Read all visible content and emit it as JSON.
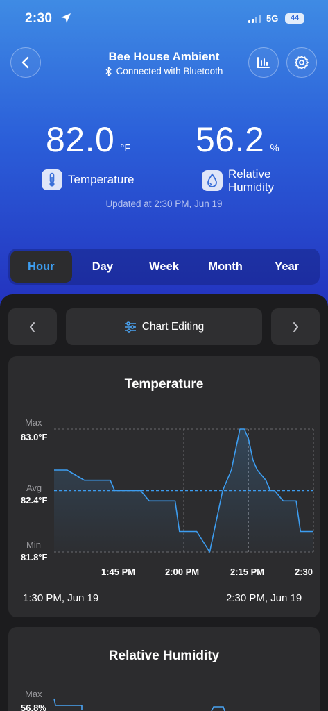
{
  "status": {
    "time": "2:30",
    "network": "5G",
    "battery": "44"
  },
  "header": {
    "title": "Bee House Ambient",
    "subtitle": "Connected with Bluetooth"
  },
  "icons": {
    "back": "chevron-left-icon",
    "bluetooth": "bluetooth-icon",
    "stats": "bar-chart-icon",
    "settings": "gear-icon",
    "thermometer": "thermometer-icon",
    "humidity": "humidity-drop-icon",
    "sliders": "sliders-icon"
  },
  "readings": {
    "temperature": {
      "value": "82.0",
      "unit": "°F",
      "label": "Temperature"
    },
    "humidity": {
      "value": "56.2",
      "unit": "%",
      "label_line1": "Relative",
      "label_line2": "Humidity"
    }
  },
  "updated": "Updated at 2:30 PM,  Jun 19",
  "tabs": [
    "Hour",
    "Day",
    "Week",
    "Month",
    "Year"
  ],
  "active_tab": "Hour",
  "toolbar": {
    "chart_editing": "Chart Editing"
  },
  "accent_color": "#3d9df0",
  "chart_data": [
    {
      "type": "line",
      "title": "Temperature",
      "y_labels": {
        "max_label": "Max",
        "max": "83.0°F",
        "avg_label": "Avg",
        "avg": "82.4°F",
        "min_label": "Min",
        "min": "81.8°F"
      },
      "ylim": [
        81.8,
        83.0
      ],
      "avg_value": 82.4,
      "x_ticks": [
        "1:45 PM",
        "2:00 PM",
        "2:15 PM",
        "2:30"
      ],
      "x_minutes": [
        0,
        3,
        7,
        13,
        14,
        20,
        22,
        28,
        29,
        33,
        36,
        37,
        38,
        39,
        41,
        42,
        43,
        44,
        45,
        46,
        47,
        49,
        50,
        51,
        53,
        56,
        57,
        60
      ],
      "y": [
        82.6,
        82.6,
        82.5,
        82.5,
        82.4,
        82.4,
        82.3,
        82.3,
        82.0,
        82.0,
        81.8,
        82.0,
        82.2,
        82.4,
        82.6,
        82.8,
        83.0,
        83.0,
        82.9,
        82.7,
        82.6,
        82.5,
        82.4,
        82.4,
        82.3,
        82.3,
        82.0,
        82.0
      ],
      "range_start": "1:30 PM,  Jun 19",
      "range_end": "2:30 PM,  Jun 19",
      "grid": true
    },
    {
      "type": "line",
      "title": "Relative Humidity",
      "y_labels": {
        "max_label": "Max",
        "max": "56.8%"
      }
    }
  ]
}
